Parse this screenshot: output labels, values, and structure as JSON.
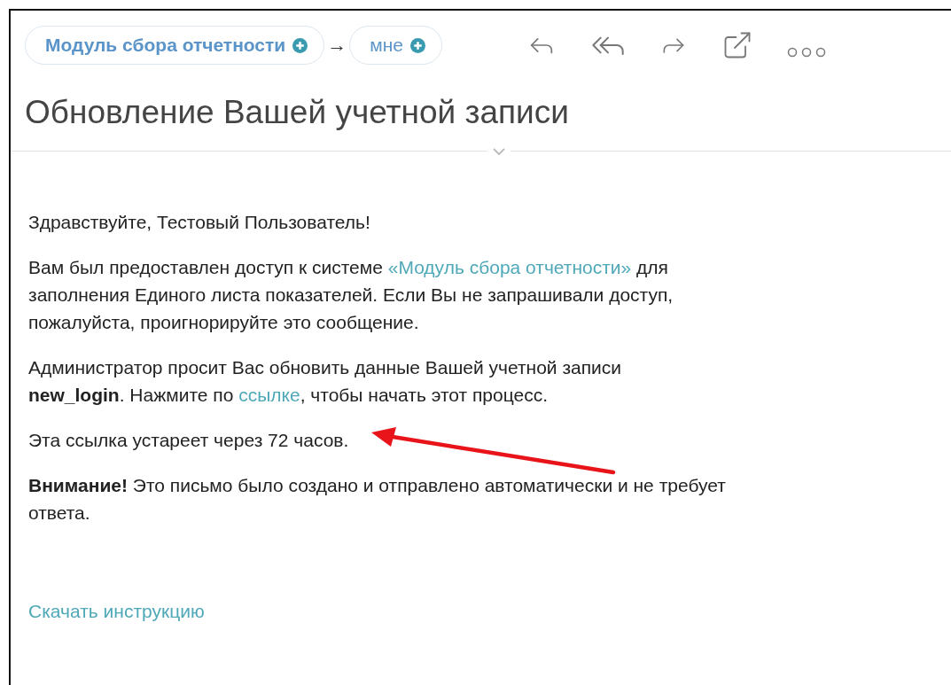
{
  "header": {
    "sender": {
      "label": "Модуль сбора отчетности"
    },
    "arrow": "→",
    "recipient": {
      "label": "мне"
    }
  },
  "subject": "Обновление Вашей учетной записи",
  "body": [
    {
      "segments": [
        {
          "kind": "text",
          "text": "Здравствуйте, Тестовый Пользователь!"
        }
      ]
    },
    {
      "segments": [
        {
          "kind": "text",
          "text": "Вам был предоставлен доступ к системе "
        },
        {
          "kind": "link",
          "text": "«Модуль сбора отчетности»"
        },
        {
          "kind": "text",
          "text": " для\nзаполнения Единого листа показателей. Если Вы не запрашивали доступ,\nпожалуйста, проигнорируйте это сообщение."
        }
      ]
    },
    {
      "segments": [
        {
          "kind": "text",
          "text": "Администратор просит Вас обновить данные Вашей учетной записи\n"
        },
        {
          "kind": "bold",
          "text": "new_login"
        },
        {
          "kind": "text",
          "text": ". Нажмите по "
        },
        {
          "kind": "link",
          "text": "ссылке"
        },
        {
          "kind": "text",
          "text": ", чтобы начать этот процесс."
        }
      ]
    },
    {
      "segments": [
        {
          "kind": "text",
          "text": "Эта ссылка устареет через 72 часов."
        }
      ]
    },
    {
      "segments": [
        {
          "kind": "bold",
          "text": "Внимание!"
        },
        {
          "kind": "text",
          "text": " Это письмо было создано и отправлено автоматически и не требует\nответа."
        }
      ]
    }
  ],
  "download_link": "Скачать инструкцию"
}
